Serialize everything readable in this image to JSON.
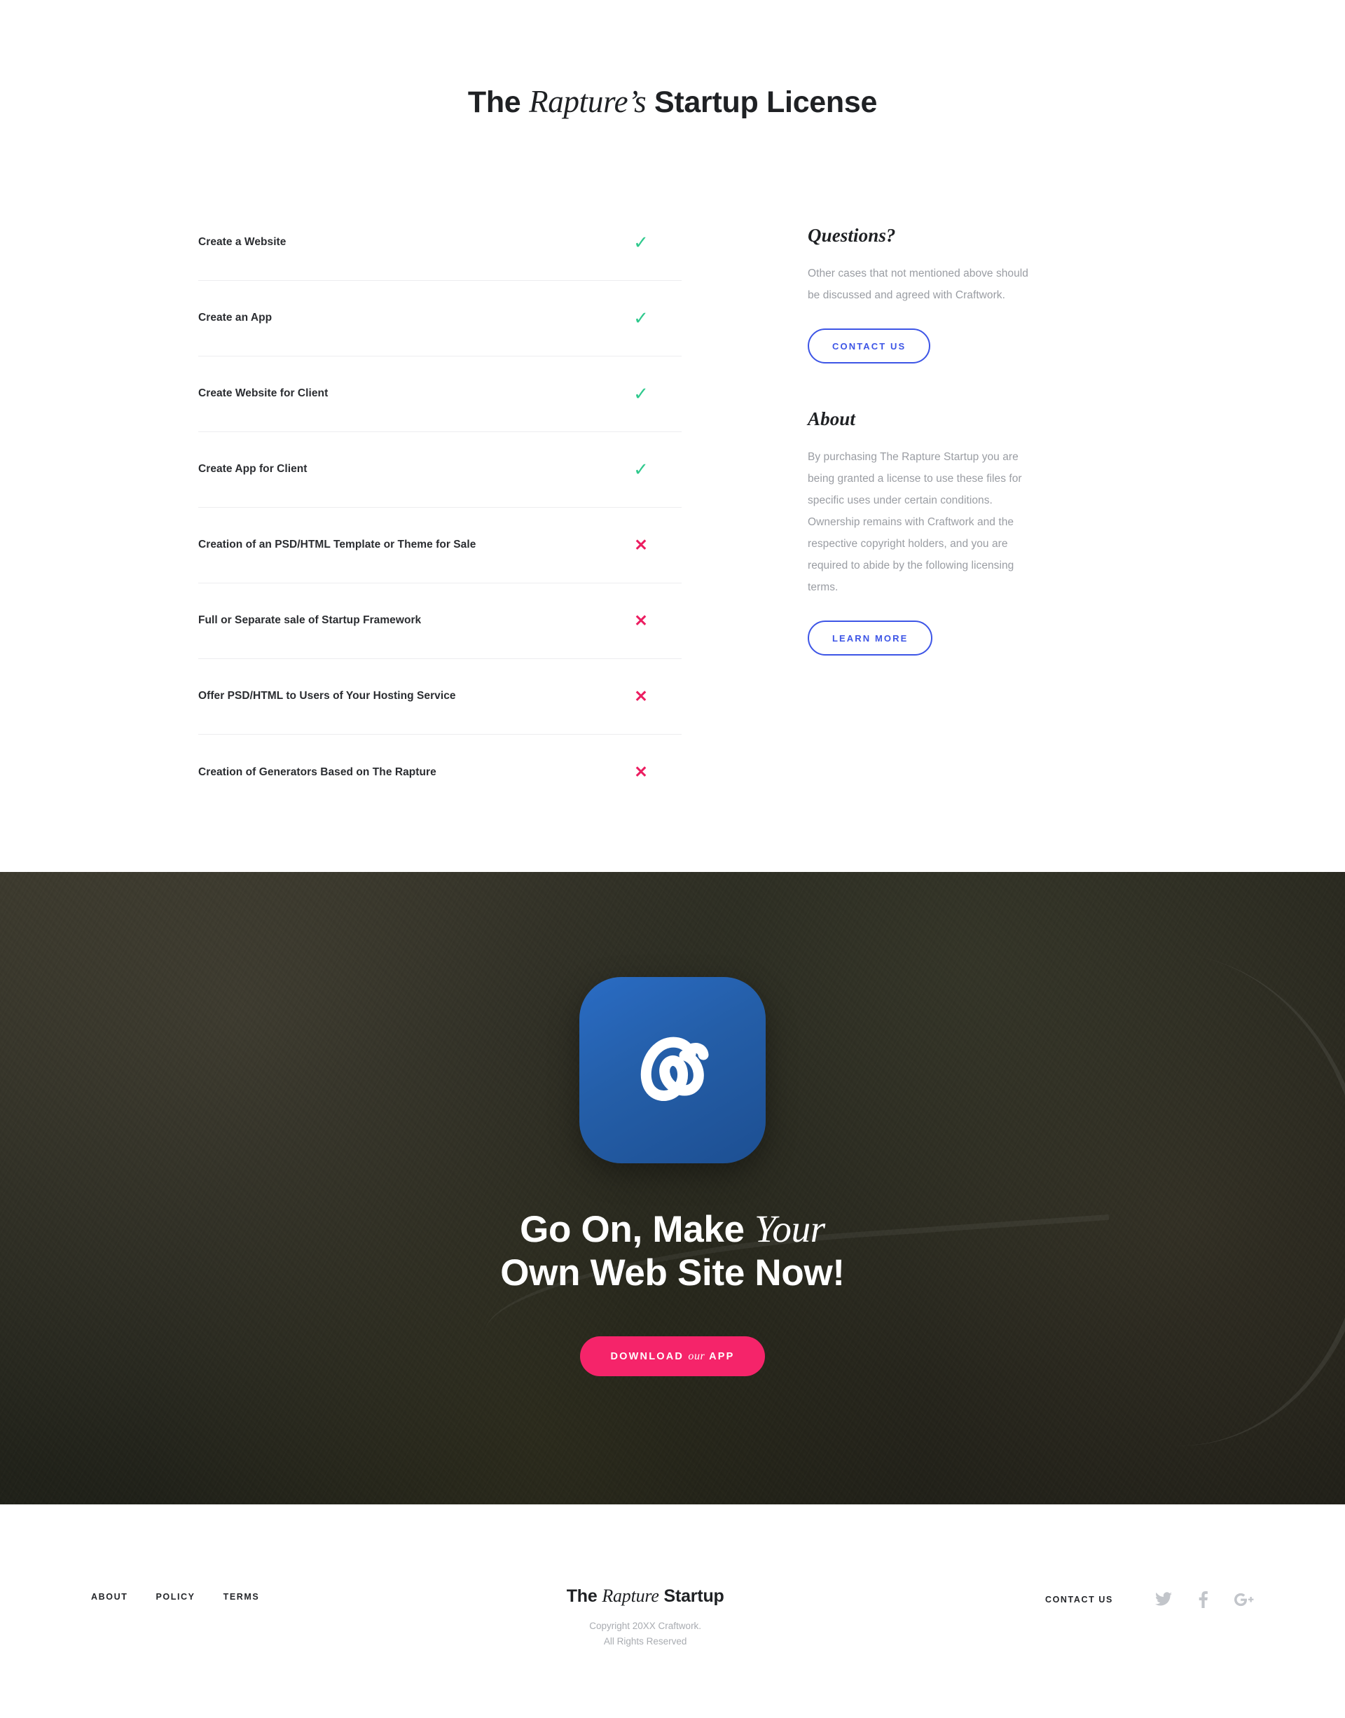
{
  "license": {
    "title_part1": "The ",
    "title_italic": "Rapture’s",
    "title_part2": " Startup License",
    "rows": [
      {
        "label": "Create a Website",
        "mark": "✓",
        "allowed": true
      },
      {
        "label": "Create an App",
        "mark": "✓",
        "allowed": true
      },
      {
        "label": "Create Website for Client",
        "mark": "✓",
        "allowed": true
      },
      {
        "label": "Create App for Client",
        "mark": "✓",
        "allowed": true
      },
      {
        "label": "Creation of an PSD/HTML Template or Theme for Sale",
        "mark": "✕",
        "allowed": false
      },
      {
        "label": "Full or Separate sale of Startup Framework",
        "mark": "✕",
        "allowed": false
      },
      {
        "label": "Offer PSD/HTML to Users of Your Hosting Service",
        "mark": "✕",
        "allowed": false
      },
      {
        "label": "Creation of Generators Based on The Rapture",
        "mark": "✕",
        "allowed": false
      }
    ],
    "questions": {
      "heading": "Questions?",
      "body": "Other cases that not mentioned above should be discussed and agreed with Craftwork.",
      "button": "CONTACT US"
    },
    "about": {
      "heading": "About",
      "body": "By purchasing The Rapture Startup you are being granted a license to use these files for specific uses under certain conditions. Ownership remains with Craftwork and the respective copyright holders, and you are required to abide by the following licensing terms.",
      "button": "LEARN MORE"
    }
  },
  "hero": {
    "app_icon_name": "rapture-app-icon",
    "headline_line1_part1": "Go On, Make ",
    "headline_line1_italic": "Your",
    "headline_line2": "Own Web Site Now!",
    "cta_part1": "DOWNLOAD ",
    "cta_italic": "our",
    "cta_part2": " APP"
  },
  "footer": {
    "nav": [
      "ABOUT",
      "POLICY",
      "TERMS"
    ],
    "logo_part1": "The ",
    "logo_italic": "Rapture",
    "logo_part2": " Startup",
    "copyright_line1": "Copyright 20XX Craftwork.",
    "copyright_line2": "All Rights Reserved",
    "contact_label": "CONTACT US",
    "socials": [
      "twitter-icon",
      "facebook-icon",
      "google-plus-icon"
    ]
  },
  "colors": {
    "accent_blue": "#3d55e6",
    "accent_pink": "#f5246a",
    "check_green": "#2fc98d",
    "cross_pink": "#ec1e61",
    "text_dark": "#1f2124",
    "text_muted": "#9a9da3"
  }
}
